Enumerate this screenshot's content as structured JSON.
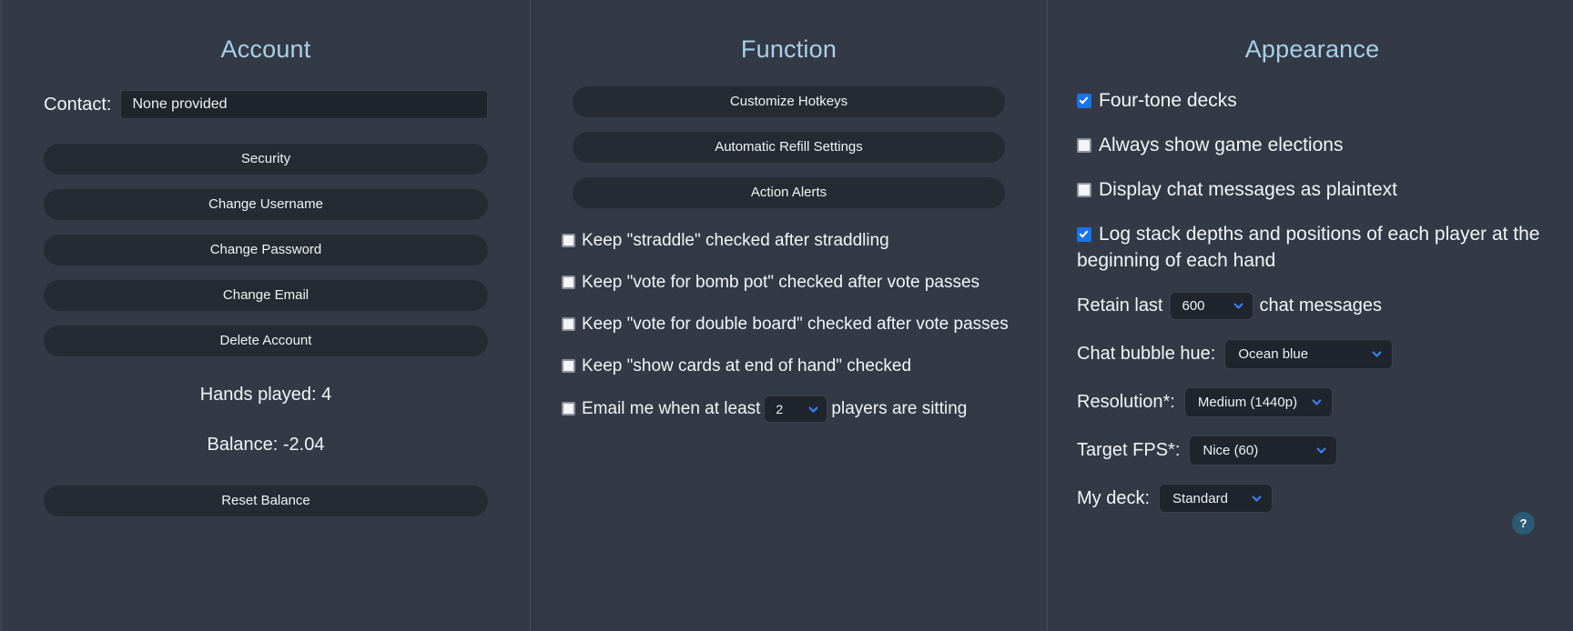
{
  "account": {
    "title": "Account",
    "contact_label": "Contact:",
    "contact_value": "None provided",
    "buttons": [
      {
        "label": "Security"
      },
      {
        "label": "Change Username"
      },
      {
        "label": "Change Password"
      },
      {
        "label": "Change Email"
      },
      {
        "label": "Delete Account"
      }
    ],
    "hands_played": "Hands played: 4",
    "balance": "Balance: -2.04",
    "reset_label": "Reset Balance"
  },
  "function": {
    "title": "Function",
    "buttons": [
      {
        "label": "Customize Hotkeys"
      },
      {
        "label": "Automatic Refill Settings"
      },
      {
        "label": "Action Alerts"
      }
    ],
    "checkboxes": [
      {
        "label": "Keep \"straddle\" checked after straddling",
        "checked": false
      },
      {
        "label": "Keep \"vote for bomb pot\" checked after vote passes",
        "checked": false
      },
      {
        "label": "Keep \"vote for double board\" checked after vote passes",
        "checked": false
      },
      {
        "label": "Keep \"show cards at end of hand\" checked",
        "checked": false
      }
    ],
    "email_row": {
      "checked": false,
      "text_before": "Email me when at least",
      "value": "2",
      "text_after": "players are sitting"
    }
  },
  "appearance": {
    "title": "Appearance",
    "checkboxes": [
      {
        "label": "Four-tone decks",
        "checked": true
      },
      {
        "label": "Always show game elections",
        "checked": false
      },
      {
        "label": "Display chat messages as plaintext",
        "checked": false
      },
      {
        "label": "Log stack depths and positions of each player at the beginning of each hand",
        "checked": true
      }
    ],
    "retain": {
      "label_before": "Retain last",
      "value": "600",
      "label_after": "chat messages"
    },
    "chat_hue": {
      "label": "Chat bubble hue:",
      "value": "Ocean blue"
    },
    "resolution": {
      "label": "Resolution*:",
      "value": "Medium (1440p)"
    },
    "target_fps": {
      "label": "Target FPS*:",
      "value": "Nice (60)"
    },
    "my_deck": {
      "label": "My deck:",
      "value": "Standard"
    },
    "help_label": "?"
  },
  "colors": {
    "panel_bg": "#333a46",
    "control_bg": "#20242c",
    "button_bg": "#262b33",
    "title_accent": "#a9cfe8",
    "checkbox_checked": "#1a73e8",
    "chevron": "#3b82f6",
    "help_bg": "#2b5b74"
  }
}
